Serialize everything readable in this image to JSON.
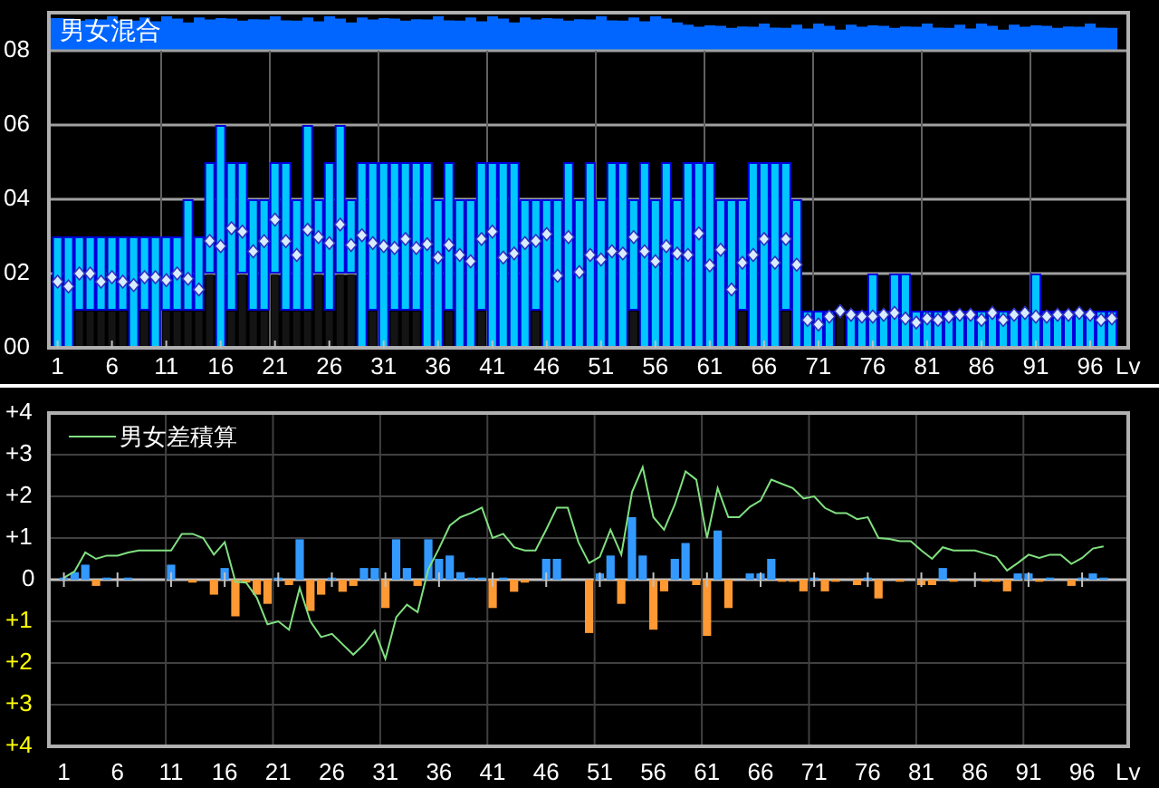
{
  "charts": [
    {
      "chart_data": {
        "type": "bar",
        "title": "男女混合",
        "xlabel": "Lv",
        "stacked": true,
        "grid": true,
        "xlim": [
          0.2,
          99.5
        ],
        "x": [
          1,
          2,
          3,
          4,
          5,
          6,
          7,
          8,
          9,
          10,
          11,
          12,
          13,
          14,
          15,
          16,
          17,
          18,
          19,
          20,
          21,
          22,
          23,
          24,
          25,
          26,
          27,
          28,
          29,
          30,
          31,
          32,
          33,
          34,
          35,
          36,
          37,
          38,
          39,
          40,
          41,
          42,
          43,
          44,
          45,
          46,
          47,
          48,
          49,
          50,
          51,
          52,
          53,
          54,
          55,
          56,
          57,
          58,
          59,
          60,
          61,
          62,
          63,
          64,
          65,
          66,
          67,
          68,
          69,
          70,
          71,
          72,
          73,
          74,
          75,
          76,
          77,
          78,
          79,
          80,
          81,
          82,
          83,
          84,
          85,
          86,
          87,
          88,
          89,
          90,
          91,
          92,
          93,
          94,
          95,
          96,
          97,
          98
        ],
        "xticks": [
          1,
          6,
          11,
          16,
          21,
          26,
          31,
          36,
          41,
          46,
          51,
          56,
          61,
          66,
          71,
          76,
          81,
          86,
          91,
          96
        ],
        "ylim": [
          0,
          8
        ],
        "yticks": [
          {
            "value": 0,
            "label": "00"
          },
          {
            "value": 2,
            "label": "02"
          },
          {
            "value": 4,
            "label": "04"
          },
          {
            "value": 6,
            "label": "06"
          },
          {
            "value": 8,
            "label": "08"
          }
        ],
        "series": [
          {
            "color": "#141414",
            "values": [
              0,
              0,
              1,
              1,
              1,
              1,
              1,
              0,
              1,
              0,
              1,
              1,
              1,
              1,
              2,
              0,
              1,
              2,
              1,
              1,
              2,
              1,
              1,
              1,
              2,
              1,
              2,
              2,
              0,
              1,
              0,
              1,
              1,
              1,
              0,
              0,
              1,
              0,
              0,
              1,
              0,
              0,
              0,
              0,
              1,
              0,
              0,
              0,
              0,
              0,
              0,
              0,
              0,
              1,
              0,
              0,
              0,
              0,
              0,
              0,
              0,
              0,
              0,
              1,
              0,
              0,
              0,
              1,
              0,
              0,
              0,
              0,
              1,
              0,
              0,
              0,
              0,
              0,
              0,
              0,
              0,
              0,
              0,
              0,
              0,
              0,
              0,
              0,
              0,
              0,
              0,
              0,
              0,
              0,
              0,
              0,
              0,
              0
            ]
          },
          {
            "color": "#00c8ff",
            "values": [
              3,
              3,
              2,
              2,
              2,
              2,
              2,
              3,
              2,
              3,
              2,
              2,
              3,
              2,
              3,
              6,
              4,
              3,
              3,
              3,
              3,
              4,
              3,
              5,
              2,
              4,
              4,
              2,
              5,
              4,
              5,
              4,
              4,
              4,
              5,
              4,
              4,
              4,
              4,
              4,
              5,
              5,
              5,
              4,
              3,
              4,
              4,
              5,
              4,
              5,
              4,
              5,
              5,
              3,
              5,
              4,
              5,
              4,
              5,
              5,
              5,
              4,
              4,
              3,
              5,
              5,
              5,
              4,
              4,
              1,
              1,
              1,
              null,
              1,
              1,
              2,
              1,
              2,
              2,
              1,
              1,
              1,
              1,
              1,
              1,
              1,
              1,
              1,
              1,
              1,
              2,
              1,
              1,
              1,
              1,
              1,
              1,
              1
            ]
          },
          {
            "type": "scatter",
            "color": "#d8ecff",
            "values": [
              1.78,
              1.65,
              2.0,
              2.0,
              1.78,
              1.9,
              1.78,
              1.69,
              1.9,
              1.9,
              1.82,
              2.0,
              1.86,
              1.57,
              2.88,
              2.74,
              3.22,
              3.13,
              2.6,
              2.87,
              3.45,
              2.87,
              2.5,
              3.18,
              2.98,
              2.82,
              3.32,
              2.77,
              3.03,
              2.82,
              2.74,
              2.69,
              2.93,
              2.69,
              2.79,
              2.43,
              2.77,
              2.5,
              2.33,
              2.93,
              3.13,
              2.43,
              2.54,
              2.82,
              2.88,
              3.06,
              1.94,
              2.98,
              2.04,
              2.5,
              2.38,
              2.6,
              2.54,
              2.98,
              2.6,
              2.33,
              2.74,
              2.54,
              2.5,
              3.08,
              2.22,
              2.64,
              1.57,
              2.29,
              2.5,
              2.93,
              2.29,
              2.93,
              2.24,
              0.75,
              0.63,
              0.84,
              0.99,
              0.89,
              0.84,
              0.84,
              0.89,
              0.94,
              0.79,
              0.68,
              0.79,
              0.75,
              0.84,
              0.89,
              0.89,
              0.75,
              0.94,
              0.75,
              0.89,
              0.94,
              0.84,
              0.84,
              0.89,
              0.89,
              0.94,
              0.89,
              0.75,
              0.79
            ]
          }
        ]
      }
    },
    {
      "chart_data": {
        "type": "bar",
        "xlabel": "Lv",
        "stacked": true,
        "grid": true,
        "xlim": [
          -0.4,
          100.3
        ],
        "x": [
          1,
          2,
          3,
          4,
          5,
          6,
          7,
          8,
          9,
          10,
          11,
          12,
          13,
          14,
          15,
          16,
          17,
          18,
          19,
          20,
          21,
          22,
          23,
          24,
          25,
          26,
          27,
          28,
          29,
          30,
          31,
          32,
          33,
          34,
          35,
          36,
          37,
          38,
          39,
          40,
          41,
          42,
          43,
          44,
          45,
          46,
          47,
          48,
          49,
          50,
          51,
          52,
          53,
          54,
          55,
          56,
          57,
          58,
          59,
          60,
          61,
          62,
          63,
          64,
          65,
          66,
          67,
          68,
          69,
          70,
          71,
          72,
          73,
          74,
          75,
          76,
          77,
          78,
          79,
          80,
          81,
          82,
          83,
          84,
          85,
          86,
          87,
          88,
          89,
          90,
          91,
          92,
          93,
          94,
          95,
          96,
          97,
          98
        ],
        "xticks": [
          1,
          6,
          11,
          16,
          21,
          26,
          31,
          36,
          41,
          46,
          51,
          56,
          61,
          66,
          71,
          76,
          81,
          86,
          91,
          96
        ],
        "ylim": [
          -4,
          4
        ],
        "yticks": [
          {
            "value": 4,
            "label": "+4"
          },
          {
            "value": 3,
            "label": "+3"
          },
          {
            "value": 2,
            "label": "+2"
          },
          {
            "value": 1,
            "label": "+1"
          },
          {
            "value": 0,
            "label": "0"
          },
          {
            "value": -1,
            "label": "+1"
          },
          {
            "value": -2,
            "label": "+2"
          },
          {
            "value": -3,
            "label": "+3"
          },
          {
            "value": -4,
            "label": "+4"
          }
        ],
        "series": [
          {
            "color": "#3399ff",
            "values": [
              0.05,
              0.18,
              0.36,
              null,
              0.05,
              null,
              0.05,
              null,
              null,
              null,
              0.36,
              null,
              null,
              null,
              null,
              0.28,
              null,
              null,
              null,
              null,
              0.05,
              null,
              0.97,
              null,
              null,
              0.05,
              null,
              null,
              0.28,
              0.28,
              null,
              0.97,
              0.28,
              null,
              0.97,
              0.5,
              0.58,
              0.18,
              0.05,
              0.05,
              null,
              0.05,
              null,
              null,
              null,
              0.5,
              0.5,
              null,
              null,
              null,
              0.15,
              0.58,
              null,
              1.5,
              0.58,
              null,
              null,
              0.5,
              0.88,
              null,
              null,
              1.18,
              null,
              null,
              0.15,
              0.15,
              0.5,
              null,
              null,
              null,
              0.05,
              null,
              null,
              null,
              null,
              0.05,
              null,
              null,
              null,
              null,
              null,
              null,
              0.28,
              null,
              null,
              null,
              null,
              null,
              null,
              0.15,
              0.15,
              null,
              0.05,
              null,
              null,
              0.05,
              0.15,
              0.05
            ]
          },
          {
            "color": "#ff9933",
            "values": [
              null,
              null,
              null,
              -0.15,
              null,
              null,
              null,
              null,
              null,
              null,
              null,
              null,
              -0.07,
              null,
              -0.36,
              null,
              -0.88,
              -0.07,
              -0.36,
              -0.58,
              null,
              -0.13,
              null,
              -0.75,
              -0.36,
              null,
              -0.29,
              -0.15,
              null,
              null,
              -0.68,
              null,
              null,
              -0.15,
              null,
              null,
              null,
              null,
              null,
              null,
              -0.68,
              null,
              -0.29,
              -0.07,
              null,
              null,
              null,
              null,
              null,
              -1.28,
              null,
              null,
              -0.58,
              null,
              null,
              -1.2,
              -0.28,
              null,
              null,
              -0.13,
              -1.35,
              null,
              -0.68,
              null,
              null,
              null,
              null,
              -0.05,
              -0.05,
              -0.28,
              null,
              -0.28,
              -0.05,
              null,
              -0.13,
              null,
              -0.45,
              null,
              -0.05,
              null,
              -0.13,
              -0.13,
              null,
              -0.05,
              null,
              null,
              -0.05,
              -0.05,
              -0.28,
              null,
              null,
              -0.05,
              null,
              null,
              -0.15,
              null,
              null,
              null
            ]
          },
          {
            "type": "line",
            "name": "男女差積算",
            "color": "#80e080",
            "values": [
              0.05,
              0.2,
              0.65,
              0.5,
              0.58,
              0.58,
              0.65,
              0.7,
              0.7,
              0.7,
              0.7,
              1.1,
              1.1,
              1.0,
              0.6,
              0.9,
              -0.05,
              -0.07,
              -0.43,
              -1.07,
              -1.0,
              -1.2,
              -0.2,
              -1.0,
              -1.38,
              -1.3,
              -1.55,
              -1.8,
              -1.55,
              -1.22,
              -1.9,
              -0.9,
              -0.6,
              -0.78,
              0.25,
              0.75,
              1.3,
              1.5,
              1.6,
              1.73,
              1.0,
              1.1,
              0.78,
              0.7,
              0.7,
              1.2,
              1.73,
              1.73,
              0.9,
              0.4,
              0.55,
              1.2,
              0.6,
              2.1,
              2.7,
              1.5,
              1.2,
              1.8,
              2.6,
              2.4,
              1.0,
              2.2,
              1.5,
              1.5,
              1.75,
              1.9,
              2.4,
              2.3,
              2.2,
              1.95,
              2.0,
              1.72,
              1.6,
              1.6,
              1.45,
              1.5,
              1.0,
              0.98,
              0.92,
              0.92,
              0.7,
              0.5,
              0.78,
              0.7,
              0.7,
              0.7,
              0.62,
              0.55,
              0.22,
              0.4,
              0.6,
              0.52,
              0.6,
              0.6,
              0.38,
              0.52,
              0.75,
              0.8
            ]
          }
        ]
      }
    }
  ]
}
